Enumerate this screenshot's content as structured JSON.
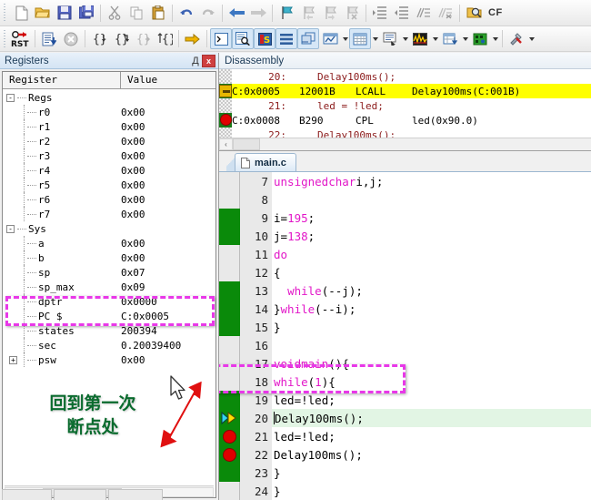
{
  "toolbar_main": {
    "items": [
      {
        "name": "new-file-icon",
        "label": "New"
      },
      {
        "name": "open-file-icon",
        "label": "Open"
      },
      {
        "name": "save-icon",
        "label": "Save"
      },
      {
        "name": "save-all-icon",
        "label": "Save All"
      },
      {
        "name": "cut-icon",
        "label": "Cut"
      },
      {
        "name": "copy-icon",
        "label": "Copy"
      },
      {
        "name": "paste-icon",
        "label": "Paste"
      },
      {
        "name": "undo-icon",
        "label": "Undo"
      },
      {
        "name": "redo-icon",
        "label": "Redo"
      },
      {
        "name": "navigate-back-icon",
        "label": "Back"
      },
      {
        "name": "navigate-forward-icon",
        "label": "Forward"
      },
      {
        "name": "bookmark-toggle-icon",
        "label": "Insert/Remove Bookmark"
      },
      {
        "name": "bookmark-prev-icon",
        "label": "Previous Bookmark"
      },
      {
        "name": "bookmark-next-icon",
        "label": "Next Bookmark"
      },
      {
        "name": "bookmark-clear-icon",
        "label": "Clear All Bookmarks"
      },
      {
        "name": "indent-increase-icon",
        "label": "Indent"
      },
      {
        "name": "indent-decrease-icon",
        "label": "Outdent"
      },
      {
        "name": "comment-lines-icon",
        "label": "Comment"
      },
      {
        "name": "uncomment-lines-icon",
        "label": "Uncomment"
      },
      {
        "name": "find-in-files-icon",
        "label": "Find in Files"
      }
    ],
    "text_label": "CF"
  },
  "toolbar_debug": {
    "items": [
      {
        "name": "reset-cpu-icon",
        "label": "RST"
      },
      {
        "name": "run-icon",
        "label": "Run"
      },
      {
        "name": "stop-icon",
        "label": "Stop"
      },
      {
        "name": "step-into-icon",
        "label": "Step"
      },
      {
        "name": "step-over-icon",
        "label": "Step Over"
      },
      {
        "name": "step-out-icon",
        "label": "Step Out"
      },
      {
        "name": "run-to-cursor-icon",
        "label": "Run to Cursor Line"
      },
      {
        "name": "show-next-statement-icon",
        "label": "Show Next Statement"
      },
      {
        "name": "command-window-icon",
        "label": "Command Window"
      },
      {
        "name": "disassembly-window-icon",
        "label": "Disassembly Window"
      },
      {
        "name": "symbols-window-icon",
        "label": "Symbol Window"
      },
      {
        "name": "registers-window-icon",
        "label": "Registers Window"
      },
      {
        "name": "call-stack-icon",
        "label": "Call Stack Window"
      },
      {
        "name": "watch-windows-icon",
        "label": "Watch Windows"
      },
      {
        "name": "memory-windows-icon",
        "label": "Memory Windows"
      },
      {
        "name": "serial-windows-icon",
        "label": "Serial Windows"
      },
      {
        "name": "analysis-windows-icon",
        "label": "Analysis Windows"
      },
      {
        "name": "trace-windows-icon",
        "label": "Trace Windows"
      },
      {
        "name": "peripherals-icon",
        "label": "System Viewer"
      },
      {
        "name": "tools-icon",
        "label": "Tools"
      }
    ]
  },
  "registers_panel": {
    "title": "Registers",
    "pin_glyph": "Д",
    "close_glyph": "x",
    "columns": [
      "Register",
      "Value"
    ],
    "groups": [
      {
        "name": "Regs",
        "expander": "-",
        "rows": [
          {
            "name": "r0",
            "value": "0x00"
          },
          {
            "name": "r1",
            "value": "0x00"
          },
          {
            "name": "r2",
            "value": "0x00"
          },
          {
            "name": "r3",
            "value": "0x00"
          },
          {
            "name": "r4",
            "value": "0x00"
          },
          {
            "name": "r5",
            "value": "0x00"
          },
          {
            "name": "r6",
            "value": "0x00"
          },
          {
            "name": "r7",
            "value": "0x00"
          }
        ]
      },
      {
        "name": "Sys",
        "expander": "-",
        "rows": [
          {
            "name": "a",
            "value": "0x00"
          },
          {
            "name": "b",
            "value": "0x00"
          },
          {
            "name": "sp",
            "value": "0x07"
          },
          {
            "name": "sp_max",
            "value": "0x09"
          },
          {
            "name": "dptr",
            "value": "0x0000"
          },
          {
            "name": "PC  $",
            "value": "C:0x0005"
          },
          {
            "name": "states",
            "value": "200394"
          },
          {
            "name": "sec",
            "value": "0.20039400"
          },
          {
            "name": "psw",
            "value": "0x00",
            "expander": "+"
          }
        ]
      }
    ],
    "annotation_note": {
      "line1": "回到第一次",
      "line2": "断点处"
    },
    "highlight_color": "#e838e8"
  },
  "disassembly_panel": {
    "title": "Disassembly",
    "lines": [
      {
        "kind": "source",
        "num": "20:",
        "text": "Delay100ms();",
        "gutter": "none"
      },
      {
        "kind": "asm",
        "addr": "C:0x0005",
        "code": "12001B",
        "mnemonic": "LCALL",
        "operand": "Delay100ms(C:001B)",
        "gutter": "pc",
        "current": true
      },
      {
        "kind": "source",
        "num": "21:",
        "text": "led = !led;",
        "gutter": "none"
      },
      {
        "kind": "asm",
        "addr": "C:0x0008",
        "code": "B290",
        "mnemonic": "CPL",
        "operand": "led(0x90.0)",
        "gutter": "breakpoint"
      },
      {
        "kind": "source",
        "num": "22:",
        "text": "Delay100ms();",
        "gutter": "none"
      }
    ],
    "scroll_left_glyph": "‹"
  },
  "editor": {
    "tab_label": "main.c",
    "lines": [
      {
        "num": "7",
        "text": "unsigned char i, j;",
        "style": "decl",
        "gutter": "none"
      },
      {
        "num": "8",
        "text": "",
        "style": "plain",
        "gutter": "none"
      },
      {
        "num": "9",
        "text": "i = 195;",
        "style": "assign",
        "gutter": "code"
      },
      {
        "num": "10",
        "text": "j = 138;",
        "style": "assign",
        "gutter": "code"
      },
      {
        "num": "11",
        "text": "do",
        "style": "kw",
        "gutter": "none"
      },
      {
        "num": "12",
        "text": "{",
        "style": "plain",
        "gutter": "none"
      },
      {
        "num": "13",
        "text": "  while (--j);",
        "style": "kw",
        "gutter": "code"
      },
      {
        "num": "14",
        "text": "} while (--i);",
        "style": "kw",
        "gutter": "code"
      },
      {
        "num": "15",
        "text": "}",
        "style": "plain",
        "gutter": "code"
      },
      {
        "num": "16",
        "text": "",
        "style": "plain",
        "gutter": "none"
      },
      {
        "num": "17",
        "text": "void main() {",
        "style": "kw",
        "gutter": "none"
      },
      {
        "num": "18",
        "text": "while(1){",
        "style": "kw",
        "gutter": "none"
      },
      {
        "num": "19",
        "text": "led = !led;",
        "style": "plain",
        "gutter": "code"
      },
      {
        "num": "20",
        "text": "Delay100ms();",
        "style": "plain",
        "gutter": "pc",
        "highlight": true
      },
      {
        "num": "21",
        "text": "led = !led;",
        "style": "plain",
        "gutter": "breakpoint"
      },
      {
        "num": "22",
        "text": "Delay100ms();",
        "style": "plain",
        "gutter": "breakpoint"
      },
      {
        "num": "23",
        "text": "}",
        "style": "plain",
        "gutter": "code"
      },
      {
        "num": "24",
        "text": "}",
        "style": "plain",
        "gutter": "none"
      }
    ]
  }
}
